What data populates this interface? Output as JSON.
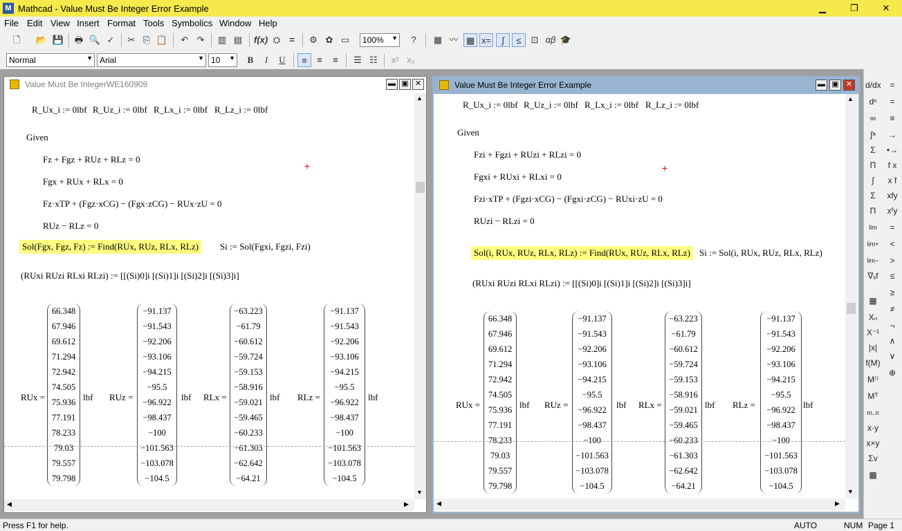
{
  "app": {
    "title": "Mathcad - Value Must Be Integer Error Example",
    "icon_letter": "M",
    "min_glyph": "▁",
    "max_glyph": "❐",
    "close_glyph": "✕"
  },
  "menu": [
    "File",
    "Edit",
    "View",
    "Insert",
    "Format",
    "Tools",
    "Symbolics",
    "Window",
    "Help"
  ],
  "toolbar": {
    "zoom": "100%",
    "style": "Normal",
    "font": "Arial",
    "font_size": "10",
    "bold": "B",
    "italic": "I",
    "underline": "U",
    "superscript": "x²",
    "subscript": "x₂"
  },
  "left_doc": {
    "title": "Value Must Be IntegerWE160909",
    "defs": [
      "R_Ux_i := 0lbf",
      "R_Uz_i := 0lbf",
      "R_Lx_i := 0lbf",
      "R_Lz_i := 0lbf"
    ],
    "given": "Given",
    "eqs": [
      "Fz + Fgz + RUz + RLz = 0",
      "Fgx + RUx + RLx = 0",
      "Fz·xTP + (Fgz·xCG) − (Fgx·zCG) − RUx·zU = 0",
      "RUz − RLz = 0"
    ],
    "sol_def": "Sol(Fgx, Fgz, Fz) := Find(RUx, RUz, RLx, RLz)",
    "s_def": "Si := Sol(Fgxi, Fgzi, Fzi)",
    "assign": "(RUxi RUzi RLxi RLzi) := [[(Si)0]i [(Si)1]i [(Si)2]i [(Si)3]i]"
  },
  "right_doc": {
    "title": "Value Must Be Integer Error Example",
    "defs": [
      "R_Ux_i := 0lbf",
      "R_Uz_i := 0lbf",
      "R_Lx_i := 0lbf",
      "R_Lz_i := 0lbf"
    ],
    "given": "Given",
    "eqs": [
      "Fzi + Fgzi + RUzi + RLzi = 0",
      "Fgxi + RUxi + RLxi = 0",
      "Fzi·xTP + (Fgzi·xCG) − (Fgxi·zCG) − RUxi·zU = 0",
      "RUzi − RLzi = 0"
    ],
    "sol_def": "Sol(i, RUx, RUz, RLx, RLz) := Find(RUx, RUz, RLx, RLz)",
    "s_def": "Si := Sol(i, RUx, RUz, RLx, RLz)",
    "assign": "(RUxi RUzi RLxi RLzi) := [[(Si)0]i [(Si)1]i [(Si)2]i [(Si)3]i]"
  },
  "results": {
    "unit": "lbf",
    "labels": [
      "RUx =",
      "RUz =",
      "RLx =",
      "RLz ="
    ],
    "RUx": [
      "66.348",
      "67.946",
      "69.612",
      "71.294",
      "72.942",
      "74.505",
      "75.936",
      "77.191",
      "78.233",
      "79.03",
      "79.557",
      "79.798"
    ],
    "RUz": [
      "−91.137",
      "−91.543",
      "−92.206",
      "−93.106",
      "−94.215",
      "−95.5",
      "−96.922",
      "−98.437",
      "−100",
      "−101.563",
      "−103.078",
      "−104.5"
    ],
    "RLx": [
      "−63.223",
      "−61.79",
      "−60.612",
      "−59.724",
      "−59.153",
      "−58.916",
      "−59.021",
      "−59.465",
      "−60.233",
      "−61.303",
      "−62.642",
      "−64.21"
    ],
    "RLz": [
      "−91.137",
      "−91.543",
      "−92.206",
      "−93.106",
      "−94.215",
      "−95.5",
      "−96.922",
      "−98.437",
      "−100",
      "−101.563",
      "−103.078",
      "−104.5"
    ]
  },
  "status": {
    "help": "Press F1 for help.",
    "mode": "AUTO",
    "num": "NUM",
    "page": "Page 1"
  }
}
